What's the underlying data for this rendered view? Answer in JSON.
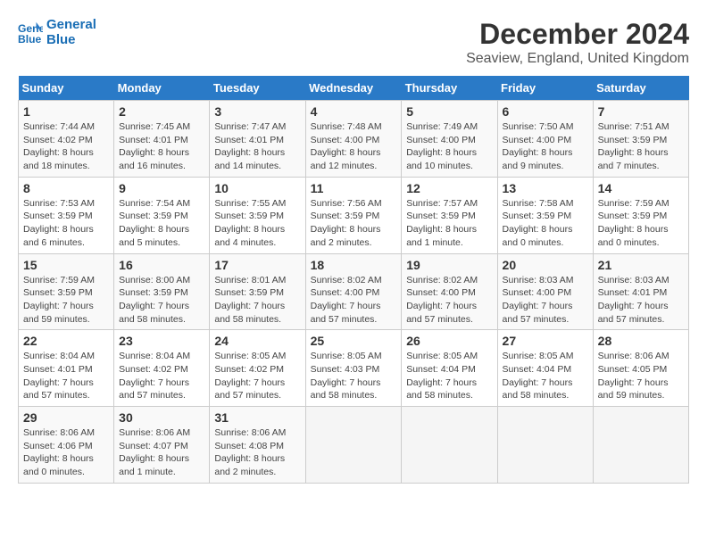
{
  "header": {
    "logo_line1": "General",
    "logo_line2": "Blue",
    "month": "December 2024",
    "location": "Seaview, England, United Kingdom"
  },
  "weekdays": [
    "Sunday",
    "Monday",
    "Tuesday",
    "Wednesday",
    "Thursday",
    "Friday",
    "Saturday"
  ],
  "weeks": [
    [
      {
        "day": "1",
        "rise": "7:44 AM",
        "set": "4:02 PM",
        "daylight": "8 hours and 18 minutes."
      },
      {
        "day": "2",
        "rise": "7:45 AM",
        "set": "4:01 PM",
        "daylight": "8 hours and 16 minutes."
      },
      {
        "day": "3",
        "rise": "7:47 AM",
        "set": "4:01 PM",
        "daylight": "8 hours and 14 minutes."
      },
      {
        "day": "4",
        "rise": "7:48 AM",
        "set": "4:00 PM",
        "daylight": "8 hours and 12 minutes."
      },
      {
        "day": "5",
        "rise": "7:49 AM",
        "set": "4:00 PM",
        "daylight": "8 hours and 10 minutes."
      },
      {
        "day": "6",
        "rise": "7:50 AM",
        "set": "4:00 PM",
        "daylight": "8 hours and 9 minutes."
      },
      {
        "day": "7",
        "rise": "7:51 AM",
        "set": "3:59 PM",
        "daylight": "8 hours and 7 minutes."
      }
    ],
    [
      {
        "day": "8",
        "rise": "7:53 AM",
        "set": "3:59 PM",
        "daylight": "8 hours and 6 minutes."
      },
      {
        "day": "9",
        "rise": "7:54 AM",
        "set": "3:59 PM",
        "daylight": "8 hours and 5 minutes."
      },
      {
        "day": "10",
        "rise": "7:55 AM",
        "set": "3:59 PM",
        "daylight": "8 hours and 4 minutes."
      },
      {
        "day": "11",
        "rise": "7:56 AM",
        "set": "3:59 PM",
        "daylight": "8 hours and 2 minutes."
      },
      {
        "day": "12",
        "rise": "7:57 AM",
        "set": "3:59 PM",
        "daylight": "8 hours and 1 minute."
      },
      {
        "day": "13",
        "rise": "7:58 AM",
        "set": "3:59 PM",
        "daylight": "8 hours and 0 minutes."
      },
      {
        "day": "14",
        "rise": "7:59 AM",
        "set": "3:59 PM",
        "daylight": "8 hours and 0 minutes."
      }
    ],
    [
      {
        "day": "15",
        "rise": "7:59 AM",
        "set": "3:59 PM",
        "daylight": "7 hours and 59 minutes."
      },
      {
        "day": "16",
        "rise": "8:00 AM",
        "set": "3:59 PM",
        "daylight": "7 hours and 58 minutes."
      },
      {
        "day": "17",
        "rise": "8:01 AM",
        "set": "3:59 PM",
        "daylight": "7 hours and 58 minutes."
      },
      {
        "day": "18",
        "rise": "8:02 AM",
        "set": "4:00 PM",
        "daylight": "7 hours and 57 minutes."
      },
      {
        "day": "19",
        "rise": "8:02 AM",
        "set": "4:00 PM",
        "daylight": "7 hours and 57 minutes."
      },
      {
        "day": "20",
        "rise": "8:03 AM",
        "set": "4:00 PM",
        "daylight": "7 hours and 57 minutes."
      },
      {
        "day": "21",
        "rise": "8:03 AM",
        "set": "4:01 PM",
        "daylight": "7 hours and 57 minutes."
      }
    ],
    [
      {
        "day": "22",
        "rise": "8:04 AM",
        "set": "4:01 PM",
        "daylight": "7 hours and 57 minutes."
      },
      {
        "day": "23",
        "rise": "8:04 AM",
        "set": "4:02 PM",
        "daylight": "7 hours and 57 minutes."
      },
      {
        "day": "24",
        "rise": "8:05 AM",
        "set": "4:02 PM",
        "daylight": "7 hours and 57 minutes."
      },
      {
        "day": "25",
        "rise": "8:05 AM",
        "set": "4:03 PM",
        "daylight": "7 hours and 58 minutes."
      },
      {
        "day": "26",
        "rise": "8:05 AM",
        "set": "4:04 PM",
        "daylight": "7 hours and 58 minutes."
      },
      {
        "day": "27",
        "rise": "8:05 AM",
        "set": "4:04 PM",
        "daylight": "7 hours and 58 minutes."
      },
      {
        "day": "28",
        "rise": "8:06 AM",
        "set": "4:05 PM",
        "daylight": "7 hours and 59 minutes."
      }
    ],
    [
      {
        "day": "29",
        "rise": "8:06 AM",
        "set": "4:06 PM",
        "daylight": "8 hours and 0 minutes."
      },
      {
        "day": "30",
        "rise": "8:06 AM",
        "set": "4:07 PM",
        "daylight": "8 hours and 1 minute."
      },
      {
        "day": "31",
        "rise": "8:06 AM",
        "set": "4:08 PM",
        "daylight": "8 hours and 2 minutes."
      },
      null,
      null,
      null,
      null
    ]
  ]
}
